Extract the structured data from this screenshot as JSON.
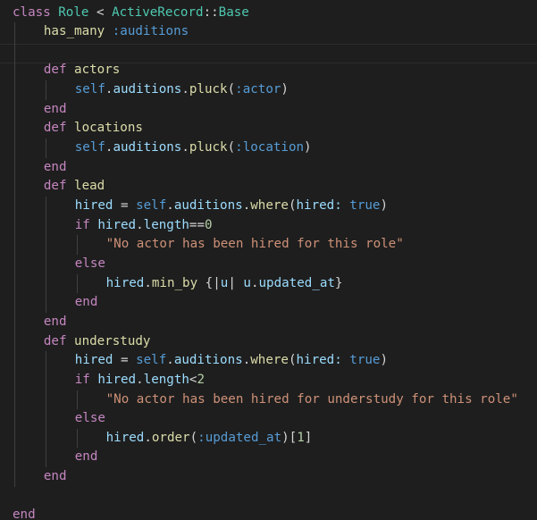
{
  "colors": {
    "background": "#1e1e1e",
    "keyword": "#c586c0",
    "type": "#4ec9b0",
    "variable": "#9cdcfe",
    "method": "#dcdcaa",
    "self": "#569cd6",
    "symbol": "#569cd6",
    "string": "#ce9178",
    "number": "#b5cea8",
    "plain": "#d4d4d4",
    "indent_guide": "#404040"
  },
  "code_lines": [
    {
      "indent": 0,
      "tokens": [
        [
          "class",
          "keyword"
        ],
        [
          " ",
          "plain"
        ],
        [
          "Role",
          "type"
        ],
        [
          " < ",
          "plain"
        ],
        [
          "ActiveRecord",
          "type"
        ],
        [
          "::",
          "plain"
        ],
        [
          "Base",
          "type"
        ]
      ]
    },
    {
      "indent": 1,
      "tokens": [
        [
          "has_many",
          "method"
        ],
        [
          " ",
          "plain"
        ],
        [
          ":auditions",
          "symbol"
        ]
      ]
    },
    {
      "indent": 1,
      "tokens": []
    },
    {
      "indent": 1,
      "tokens": [
        [
          "def",
          "keyword"
        ],
        [
          " ",
          "plain"
        ],
        [
          "actors",
          "method"
        ]
      ]
    },
    {
      "indent": 2,
      "tokens": [
        [
          "self",
          "self"
        ],
        [
          ".",
          "plain"
        ],
        [
          "auditions",
          "variable"
        ],
        [
          ".",
          "plain"
        ],
        [
          "pluck",
          "method"
        ],
        [
          "(",
          "plain"
        ],
        [
          ":actor",
          "symbol"
        ],
        [
          ")",
          "plain"
        ]
      ]
    },
    {
      "indent": 1,
      "tokens": [
        [
          "end",
          "keyword"
        ]
      ]
    },
    {
      "indent": 1,
      "tokens": [
        [
          "def",
          "keyword"
        ],
        [
          " ",
          "plain"
        ],
        [
          "locations",
          "method"
        ]
      ]
    },
    {
      "indent": 2,
      "tokens": [
        [
          "self",
          "self"
        ],
        [
          ".",
          "plain"
        ],
        [
          "auditions",
          "variable"
        ],
        [
          ".",
          "plain"
        ],
        [
          "pluck",
          "method"
        ],
        [
          "(",
          "plain"
        ],
        [
          ":location",
          "symbol"
        ],
        [
          ")",
          "plain"
        ]
      ]
    },
    {
      "indent": 1,
      "tokens": [
        [
          "end",
          "keyword"
        ]
      ]
    },
    {
      "indent": 1,
      "tokens": [
        [
          "def",
          "keyword"
        ],
        [
          " ",
          "plain"
        ],
        [
          "lead",
          "method"
        ]
      ]
    },
    {
      "indent": 2,
      "tokens": [
        [
          "hired",
          "variable"
        ],
        [
          " = ",
          "plain"
        ],
        [
          "self",
          "self"
        ],
        [
          ".",
          "plain"
        ],
        [
          "auditions",
          "variable"
        ],
        [
          ".",
          "plain"
        ],
        [
          "where",
          "method"
        ],
        [
          "(",
          "plain"
        ],
        [
          "hired:",
          "variable"
        ],
        [
          " ",
          "plain"
        ],
        [
          "true",
          "self"
        ],
        [
          ")",
          "plain"
        ]
      ]
    },
    {
      "indent": 2,
      "tokens": [
        [
          "if",
          "keyword"
        ],
        [
          " ",
          "plain"
        ],
        [
          "hired",
          "variable"
        ],
        [
          ".",
          "plain"
        ],
        [
          "length",
          "variable"
        ],
        [
          "==",
          "plain"
        ],
        [
          "0",
          "number"
        ]
      ]
    },
    {
      "indent": 3,
      "tokens": [
        [
          "\"No actor has been hired for this role\"",
          "string"
        ]
      ]
    },
    {
      "indent": 2,
      "tokens": [
        [
          "else",
          "keyword"
        ]
      ]
    },
    {
      "indent": 3,
      "tokens": [
        [
          "hired",
          "variable"
        ],
        [
          ".",
          "plain"
        ],
        [
          "min_by",
          "method"
        ],
        [
          " {|",
          "plain"
        ],
        [
          "u",
          "variable"
        ],
        [
          "|",
          "plain"
        ],
        [
          " ",
          "plain"
        ],
        [
          "u",
          "variable"
        ],
        [
          ".",
          "plain"
        ],
        [
          "updated_at",
          "variable"
        ],
        [
          "}",
          "plain"
        ]
      ]
    },
    {
      "indent": 2,
      "tokens": [
        [
          "end",
          "keyword"
        ]
      ]
    },
    {
      "indent": 1,
      "tokens": [
        [
          "end",
          "keyword"
        ]
      ]
    },
    {
      "indent": 1,
      "tokens": [
        [
          "def",
          "keyword"
        ],
        [
          " ",
          "plain"
        ],
        [
          "understudy",
          "method"
        ]
      ]
    },
    {
      "indent": 2,
      "tokens": [
        [
          "hired",
          "variable"
        ],
        [
          " = ",
          "plain"
        ],
        [
          "self",
          "self"
        ],
        [
          ".",
          "plain"
        ],
        [
          "auditions",
          "variable"
        ],
        [
          ".",
          "plain"
        ],
        [
          "where",
          "method"
        ],
        [
          "(",
          "plain"
        ],
        [
          "hired:",
          "variable"
        ],
        [
          " ",
          "plain"
        ],
        [
          "true",
          "self"
        ],
        [
          ")",
          "plain"
        ]
      ]
    },
    {
      "indent": 2,
      "tokens": [
        [
          "if",
          "keyword"
        ],
        [
          " ",
          "plain"
        ],
        [
          "hired",
          "variable"
        ],
        [
          ".",
          "plain"
        ],
        [
          "length",
          "variable"
        ],
        [
          "<",
          "plain"
        ],
        [
          "2",
          "number"
        ]
      ]
    },
    {
      "indent": 3,
      "tokens": [
        [
          "\"No actor has been hired for understudy for this role\"",
          "string"
        ]
      ]
    },
    {
      "indent": 2,
      "tokens": [
        [
          "else",
          "keyword"
        ]
      ]
    },
    {
      "indent": 3,
      "tokens": [
        [
          "hired",
          "variable"
        ],
        [
          ".",
          "plain"
        ],
        [
          "order",
          "method"
        ],
        [
          "(",
          "plain"
        ],
        [
          ":updated_at",
          "symbol"
        ],
        [
          ")",
          "plain"
        ],
        [
          "[",
          "plain"
        ],
        [
          "1",
          "number"
        ],
        [
          "]",
          "plain"
        ]
      ]
    },
    {
      "indent": 2,
      "tokens": [
        [
          "end",
          "keyword"
        ]
      ]
    },
    {
      "indent": 1,
      "tokens": [
        [
          "end",
          "keyword"
        ]
      ]
    },
    {
      "indent": 0,
      "tokens": []
    },
    {
      "indent": 0,
      "tokens": [
        [
          "end",
          "keyword"
        ]
      ]
    }
  ]
}
